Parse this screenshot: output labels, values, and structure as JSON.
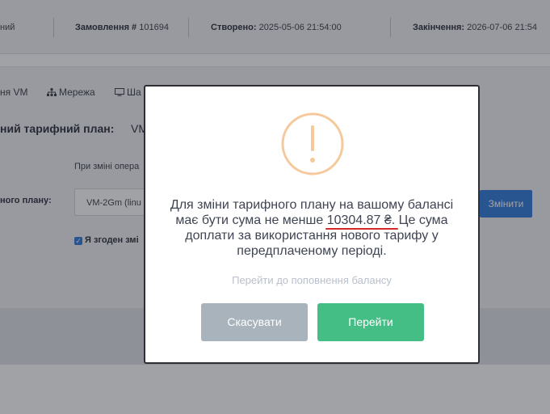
{
  "order_bar": {
    "status_fragment": "ний",
    "order_label": "Замовлення #",
    "order_number": "101694",
    "created_label": "Створено:",
    "created_value": "2025-05-06 21:54:00",
    "ends_label": "Закінчення:",
    "ends_value": "2026-07-06 21:54"
  },
  "tabs": [
    {
      "label": "ня VM",
      "icon": ""
    },
    {
      "label": "Мережа",
      "icon": "network-icon"
    },
    {
      "label": "Ша",
      "icon": "monitor-icon"
    }
  ],
  "plan": {
    "title": "ний тарифний план:",
    "current": "VM",
    "note": "При зміні опера",
    "label": "ного плану:",
    "selected": "VM-2Gm (linu",
    "change_button": "Змінити",
    "agree_text": "Я згоден змі",
    "agree_checked": true
  },
  "modal": {
    "icon": "warning-icon",
    "icon_color": "#f5c99b",
    "message_before": "Для зміни тарифного плану на вашому балансі має бути сума не менше ",
    "amount": "10304.87 ₴.",
    "message_after": " Це сума доплати за використання нового тарифу у передплаченому періоді.",
    "topup_link": "Перейти до поповнення балансу",
    "cancel_button": "Скасувати",
    "confirm_button": "Перейти",
    "cancel_color": "#a8b3bb",
    "confirm_color": "#44be84"
  }
}
